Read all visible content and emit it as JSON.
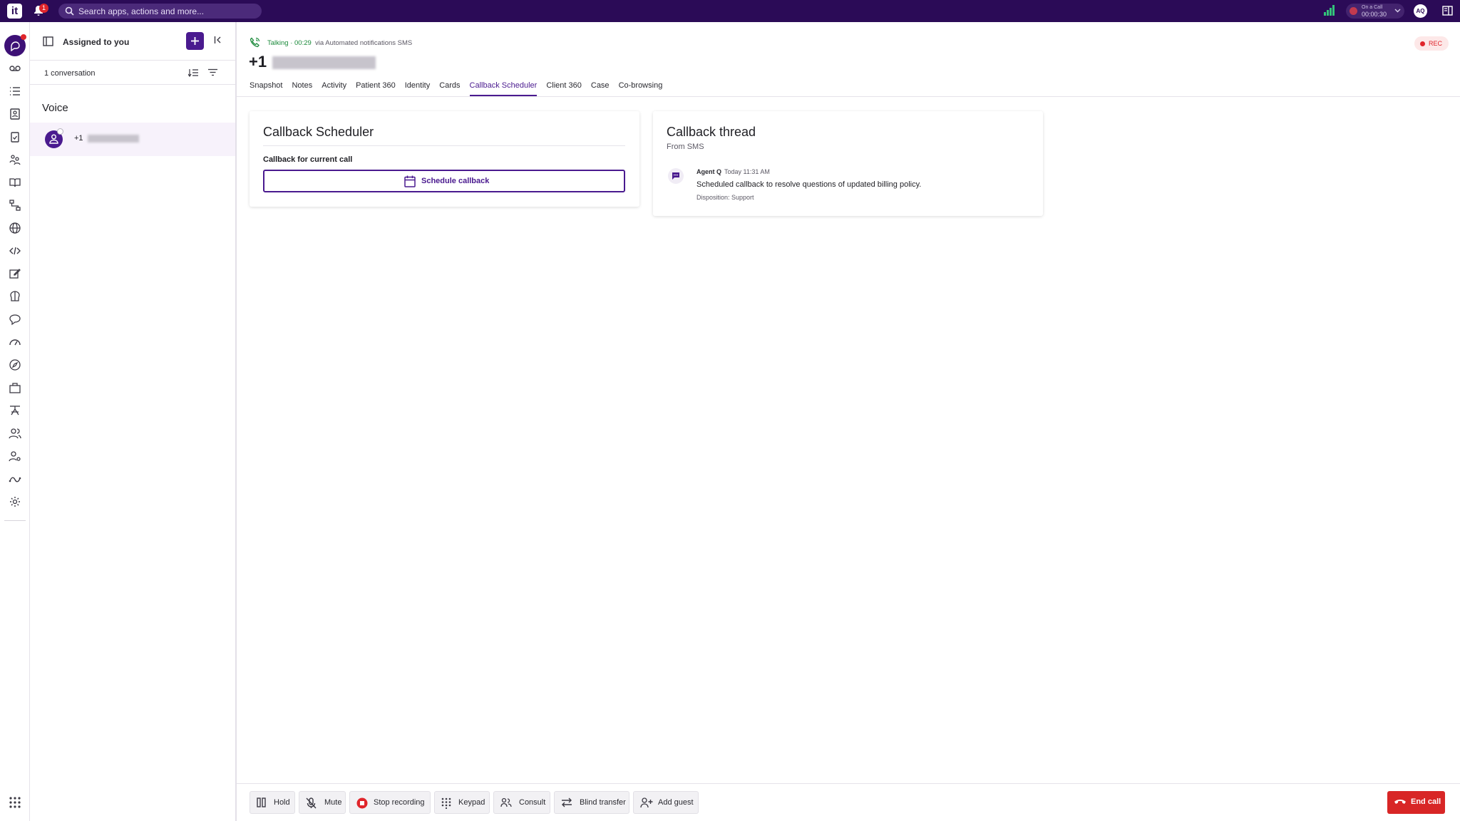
{
  "topbar": {
    "logo": "it",
    "notification_count": "1",
    "search_placeholder": "Search apps, actions and more...",
    "on_call_label": "On a Call",
    "on_call_timer": "00:00:30",
    "user_initials": "AQ"
  },
  "conversations": {
    "title": "Assigned to you",
    "count_label": "1 conversation",
    "section": "Voice",
    "items": [
      {
        "phone_prefix": "+1"
      }
    ]
  },
  "call": {
    "status": "Talking · 00:29",
    "via": "via Automated notifications SMS",
    "caller_prefix": "+1",
    "rec_label": "REC"
  },
  "tabs": [
    "Snapshot",
    "Notes",
    "Activity",
    "Patient 360",
    "Identity",
    "Cards",
    "Callback Scheduler",
    "Client 360",
    "Case",
    "Co-browsing"
  ],
  "active_tab": "Callback Scheduler",
  "scheduler": {
    "title": "Callback Scheduler",
    "subtitle": "Callback for current call",
    "button": "Schedule callback"
  },
  "thread": {
    "title": "Callback thread",
    "source": "From SMS",
    "entry": {
      "author": "Agent Q",
      "time": "Today 11:31 AM",
      "text": "Scheduled callback to resolve questions of updated billing policy.",
      "disposition": "Disposition: Support"
    }
  },
  "call_controls": {
    "hold": "Hold",
    "mute": "Mute",
    "stop_recording": "Stop recording",
    "keypad": "Keypad",
    "consult": "Consult",
    "blind_transfer": "Blind transfer",
    "add_guest": "Add guest",
    "end_call": "End call"
  },
  "colors": {
    "brand": "#2b0b57",
    "accent": "#4a1a8f",
    "status_green": "#1b8a3b",
    "danger": "#d82626"
  },
  "rail_icons": [
    "conversations-icon",
    "voicemail-icon",
    "list-icon",
    "contacts-icon",
    "tasks-icon",
    "team-icon",
    "knowledge-icon",
    "flows-icon",
    "globe-icon",
    "code-icon",
    "edit-icon",
    "ai-brain-icon",
    "chat-bubble-icon",
    "dashboard-gauge-icon",
    "compass-icon",
    "briefcase-icon",
    "org-chart-icon",
    "users-icon",
    "user-settings-icon",
    "routing-icon",
    "settings-gear-icon",
    "apps-grid-icon"
  ]
}
